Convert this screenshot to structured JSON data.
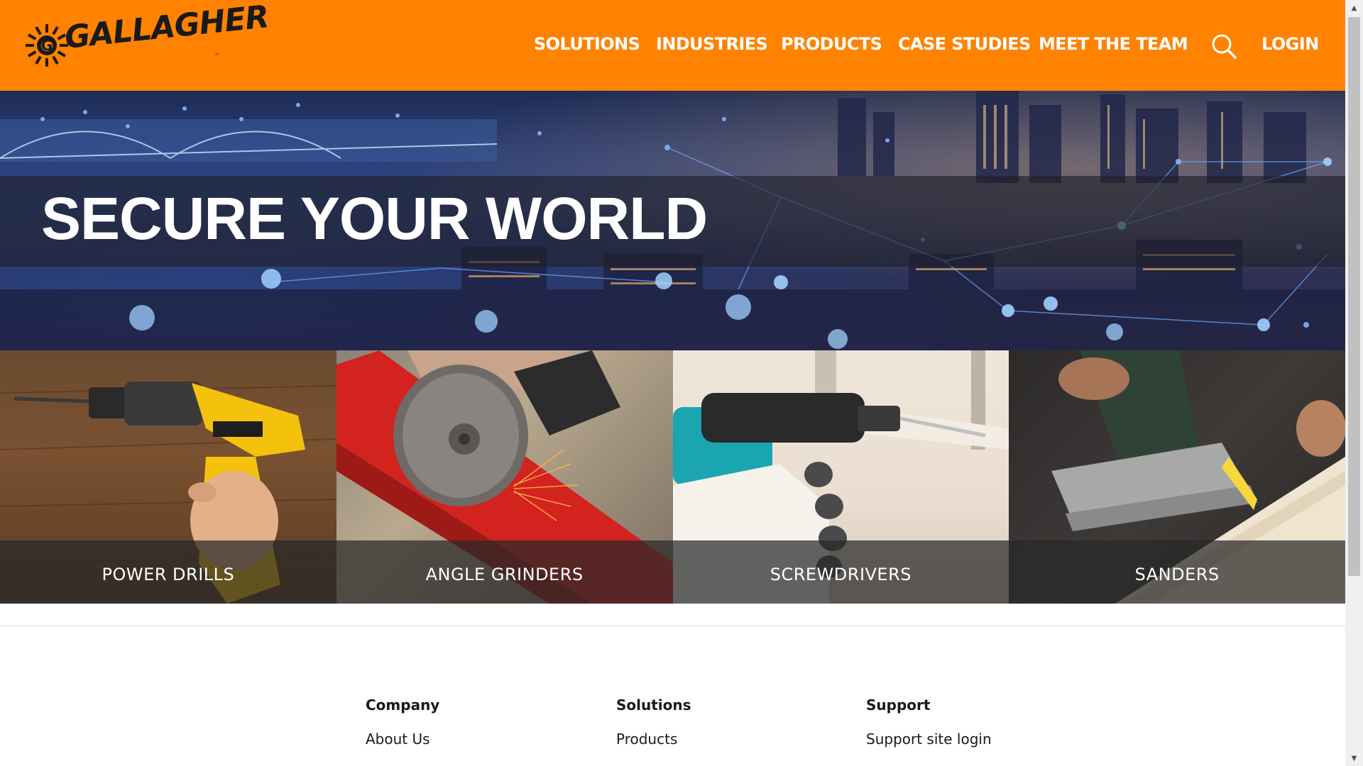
{
  "header": {
    "brand": "GALLAGHER",
    "nav": {
      "solutions": "SOLUTIONS",
      "industries": "INDUSTRIES",
      "products": "PRODUCTS",
      "case_studies": "CASE STUDIES",
      "meet_the_team": "MEET THE TEAM"
    },
    "search_icon": "search-icon",
    "login": "LOGIN",
    "accent_color": "#ff8200"
  },
  "hero": {
    "title": "SECURE YOUR WORLD"
  },
  "tiles": [
    {
      "label": "POWER DRILLS"
    },
    {
      "label": "ANGLE GRINDERS"
    },
    {
      "label": "SCREWDRIVERS"
    },
    {
      "label": "SANDERS"
    }
  ],
  "footer": {
    "company": {
      "heading": "Company",
      "links": [
        "About Us"
      ]
    },
    "solutions": {
      "heading": "Solutions",
      "links": [
        "Products"
      ]
    },
    "support": {
      "heading": "Support",
      "links": [
        "Support site login"
      ]
    }
  }
}
